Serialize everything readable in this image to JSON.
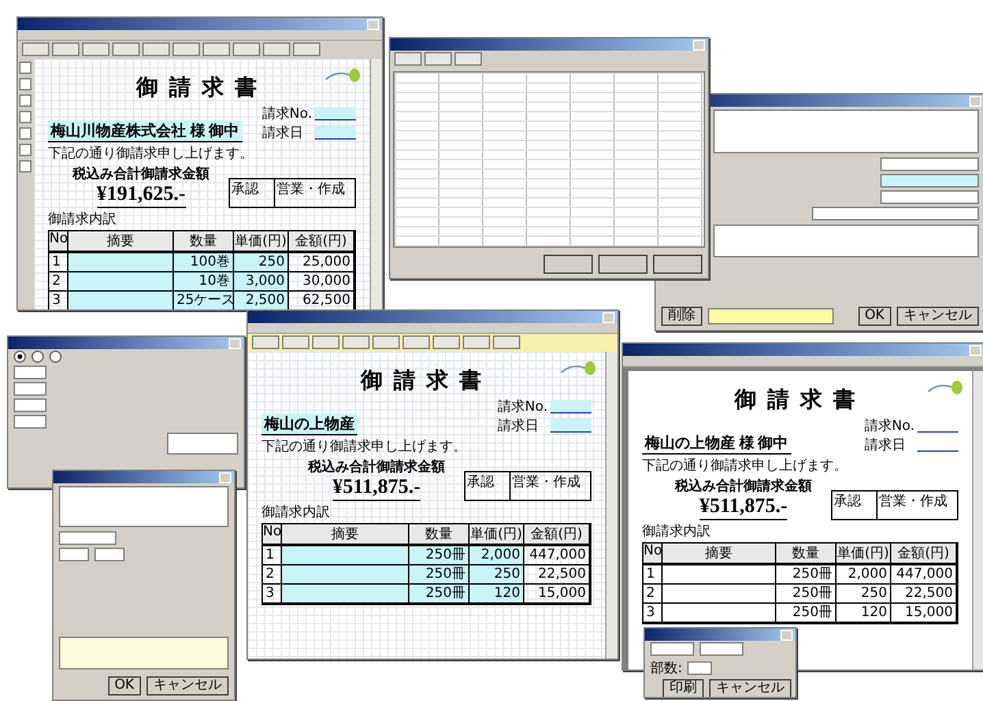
{
  "editor": {
    "doc": {
      "highlighted": true,
      "title": "御請求書",
      "customer": "梅山川物産株式会社 様 御中",
      "no_label": "請求No.",
      "date_label": "請求日",
      "note": "下記の通り御請求申し上げます。",
      "total_label": "税込み合計御請求金額",
      "total": "¥191,625.-",
      "stamps": [
        "承認",
        "営業・作成"
      ],
      "section": "御請求内訳",
      "columns": [
        "No",
        "摘要",
        "数量",
        "単価(円)",
        "金額(円)"
      ],
      "rows": [
        {
          "no": "1",
          "qty": "100巻",
          "price": "250",
          "amount": "25,000"
        },
        {
          "no": "2",
          "qty": "10巻",
          "price": "3,000",
          "amount": "30,000"
        },
        {
          "no": "3",
          "qty": "25ケース",
          "price": "2,500",
          "amount": "62,500"
        }
      ]
    }
  },
  "search_dialog": {
    "buttons": [
      "削除",
      "OK",
      "キャンセル"
    ]
  },
  "margin_dialog": {
    "options": [
      {
        "selected": true
      },
      {
        "selected": false
      },
      {
        "selected": false
      }
    ]
  },
  "text_dialog": {
    "buttons": [
      "OK",
      "キャンセル"
    ]
  },
  "editor2": {
    "doc": {
      "highlighted": true,
      "title": "御請求書",
      "customer": "梅山の上物産",
      "no_label": "請求No.",
      "date_label": "請求日",
      "note": "下記の通り御請求申し上げます。",
      "total_label": "税込み合計御請求金額",
      "total": "¥511,875.-",
      "stamps": [
        "承認",
        "営業・作成"
      ],
      "section": "御請求内訳",
      "columns": [
        "No",
        "摘要",
        "数量",
        "単価(円)",
        "金額(円)"
      ],
      "rows": [
        {
          "no": "1",
          "qty": "250冊",
          "price": "2,000",
          "amount": "447,000"
        },
        {
          "no": "2",
          "qty": "250冊",
          "price": "250",
          "amount": "22,500"
        },
        {
          "no": "3",
          "qty": "250冊",
          "price": "120",
          "amount": "15,000"
        }
      ]
    }
  },
  "preview": {
    "doc": {
      "highlighted": false,
      "title": "御請求書",
      "customer": "梅山の上物産 様 御中",
      "no_label": "請求No.",
      "date_label": "請求日",
      "note": "下記の通り御請求申し上げます。",
      "total_label": "税込み合計御請求金額",
      "total": "¥511,875.-",
      "stamps": [
        "承認",
        "営業・作成"
      ],
      "section": "御請求内訳",
      "columns": [
        "No",
        "摘要",
        "数量",
        "単価(円)",
        "金額(円)"
      ],
      "rows": [
        {
          "no": "1",
          "qty": "250冊",
          "price": "2,000",
          "amount": "447,000"
        },
        {
          "no": "2",
          "qty": "250冊",
          "price": "250",
          "amount": "22,500"
        },
        {
          "no": "3",
          "qty": "250冊",
          "price": "120",
          "amount": "15,000"
        }
      ]
    }
  },
  "print_dialog": {
    "label": "部数:",
    "buttons": [
      "印刷",
      "キャンセル"
    ]
  }
}
